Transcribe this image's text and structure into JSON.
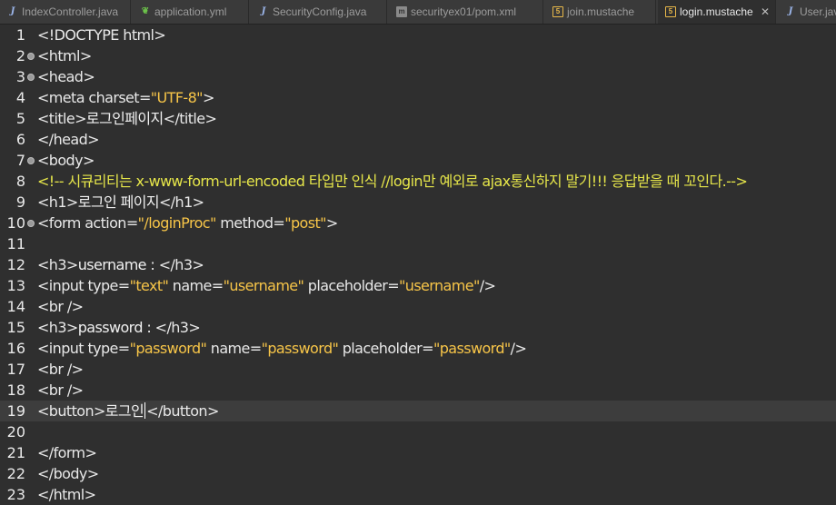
{
  "tabs": [
    {
      "label": "IndexController.java",
      "icon": "java-file-icon",
      "glyph": "J",
      "active": false
    },
    {
      "label": "application.yml",
      "icon": "yaml-leaf-icon",
      "glyph": "❦",
      "active": false
    },
    {
      "label": "SecurityConfig.java",
      "icon": "java-file-icon",
      "glyph": "J",
      "active": false
    },
    {
      "label": "securityex01/pom.xml",
      "icon": "maven-pom-icon",
      "glyph": "m",
      "active": false
    },
    {
      "label": "join.mustache",
      "icon": "html-file-icon",
      "glyph": "5",
      "active": false
    },
    {
      "label": "login.mustache",
      "icon": "html-file-icon",
      "glyph": "5",
      "active": true,
      "close": "✕"
    },
    {
      "label": "User.java",
      "icon": "java-file-icon",
      "glyph": "J",
      "active": false
    }
  ],
  "editor": {
    "current_line": 19,
    "lines": [
      {
        "n": "1",
        "fold": false,
        "tokens": [
          {
            "t": "<!DOCTYPE html>",
            "c": "tag"
          }
        ]
      },
      {
        "n": "2",
        "fold": true,
        "tokens": [
          {
            "t": "<html>",
            "c": "tag"
          }
        ]
      },
      {
        "n": "3",
        "fold": true,
        "tokens": [
          {
            "t": "<head>",
            "c": "tag"
          }
        ]
      },
      {
        "n": "4",
        "fold": false,
        "tokens": [
          {
            "t": "<meta charset=",
            "c": "tag"
          },
          {
            "t": "\"UTF-8\"",
            "c": "val"
          },
          {
            "t": ">",
            "c": "tag"
          }
        ]
      },
      {
        "n": "5",
        "fold": false,
        "tokens": [
          {
            "t": "<title>",
            "c": "tag"
          },
          {
            "t": "로그인페이지",
            "c": "text"
          },
          {
            "t": "</title>",
            "c": "tag"
          }
        ]
      },
      {
        "n": "6",
        "fold": false,
        "tokens": [
          {
            "t": "</head>",
            "c": "tag"
          }
        ]
      },
      {
        "n": "7",
        "fold": true,
        "tokens": [
          {
            "t": "<body>",
            "c": "tag"
          }
        ]
      },
      {
        "n": "8",
        "fold": false,
        "tokens": [
          {
            "t": "<!-- 시큐리티는 x-www-form-url-encoded 타입만 인식 //login만 예외로 ajax통신하지 말기!!! 응답받을 때 꼬인다.-->",
            "c": "comment"
          }
        ]
      },
      {
        "n": "9",
        "fold": false,
        "tokens": [
          {
            "t": "<h1>",
            "c": "tag"
          },
          {
            "t": "로그인 페이지",
            "c": "text"
          },
          {
            "t": "</h1>",
            "c": "tag"
          }
        ]
      },
      {
        "n": "10",
        "fold": true,
        "tokens": [
          {
            "t": "<form action=",
            "c": "tag"
          },
          {
            "t": "\"/loginProc\"",
            "c": "val"
          },
          {
            "t": " method=",
            "c": "tag"
          },
          {
            "t": "\"post\"",
            "c": "val"
          },
          {
            "t": ">",
            "c": "tag"
          }
        ]
      },
      {
        "n": "11",
        "fold": false,
        "tokens": []
      },
      {
        "n": "12",
        "fold": false,
        "tokens": [
          {
            "t": "<h3>",
            "c": "tag"
          },
          {
            "t": "username : ",
            "c": "text"
          },
          {
            "t": "</h3>",
            "c": "tag"
          }
        ]
      },
      {
        "n": "13",
        "fold": false,
        "tokens": [
          {
            "t": "<input type=",
            "c": "tag"
          },
          {
            "t": "\"text\"",
            "c": "val"
          },
          {
            "t": " name=",
            "c": "tag"
          },
          {
            "t": "\"username\"",
            "c": "val"
          },
          {
            "t": " placeholder=",
            "c": "tag"
          },
          {
            "t": "\"username\"",
            "c": "val"
          },
          {
            "t": "/>",
            "c": "tag"
          }
        ]
      },
      {
        "n": "14",
        "fold": false,
        "tokens": [
          {
            "t": "<br />",
            "c": "tag"
          }
        ]
      },
      {
        "n": "15",
        "fold": false,
        "tokens": [
          {
            "t": "<h3>",
            "c": "tag"
          },
          {
            "t": "password : ",
            "c": "text"
          },
          {
            "t": "</h3>",
            "c": "tag"
          }
        ]
      },
      {
        "n": "16",
        "fold": false,
        "tokens": [
          {
            "t": "<input type=",
            "c": "tag"
          },
          {
            "t": "\"password\"",
            "c": "val"
          },
          {
            "t": " name=",
            "c": "tag"
          },
          {
            "t": "\"password\"",
            "c": "val"
          },
          {
            "t": " placeholder=",
            "c": "tag"
          },
          {
            "t": "\"password\"",
            "c": "val"
          },
          {
            "t": "/>",
            "c": "tag"
          }
        ]
      },
      {
        "n": "17",
        "fold": false,
        "tokens": [
          {
            "t": "<br />",
            "c": "tag"
          }
        ]
      },
      {
        "n": "18",
        "fold": false,
        "tokens": [
          {
            "t": "<br />",
            "c": "tag"
          }
        ]
      },
      {
        "n": "19",
        "fold": false,
        "caret_after": 2,
        "tokens": [
          {
            "t": "<button>",
            "c": "tag"
          },
          {
            "t": "로그인",
            "c": "text"
          },
          {
            "t": "</button>",
            "c": "tag"
          }
        ]
      },
      {
        "n": "20",
        "fold": false,
        "tokens": []
      },
      {
        "n": "21",
        "fold": false,
        "tokens": [
          {
            "t": "</form>",
            "c": "tag"
          }
        ]
      },
      {
        "n": "22",
        "fold": false,
        "tokens": [
          {
            "t": "</body>",
            "c": "tag"
          }
        ]
      },
      {
        "n": "23",
        "fold": false,
        "tokens": [
          {
            "t": "</html>",
            "c": "tag"
          }
        ]
      }
    ]
  }
}
